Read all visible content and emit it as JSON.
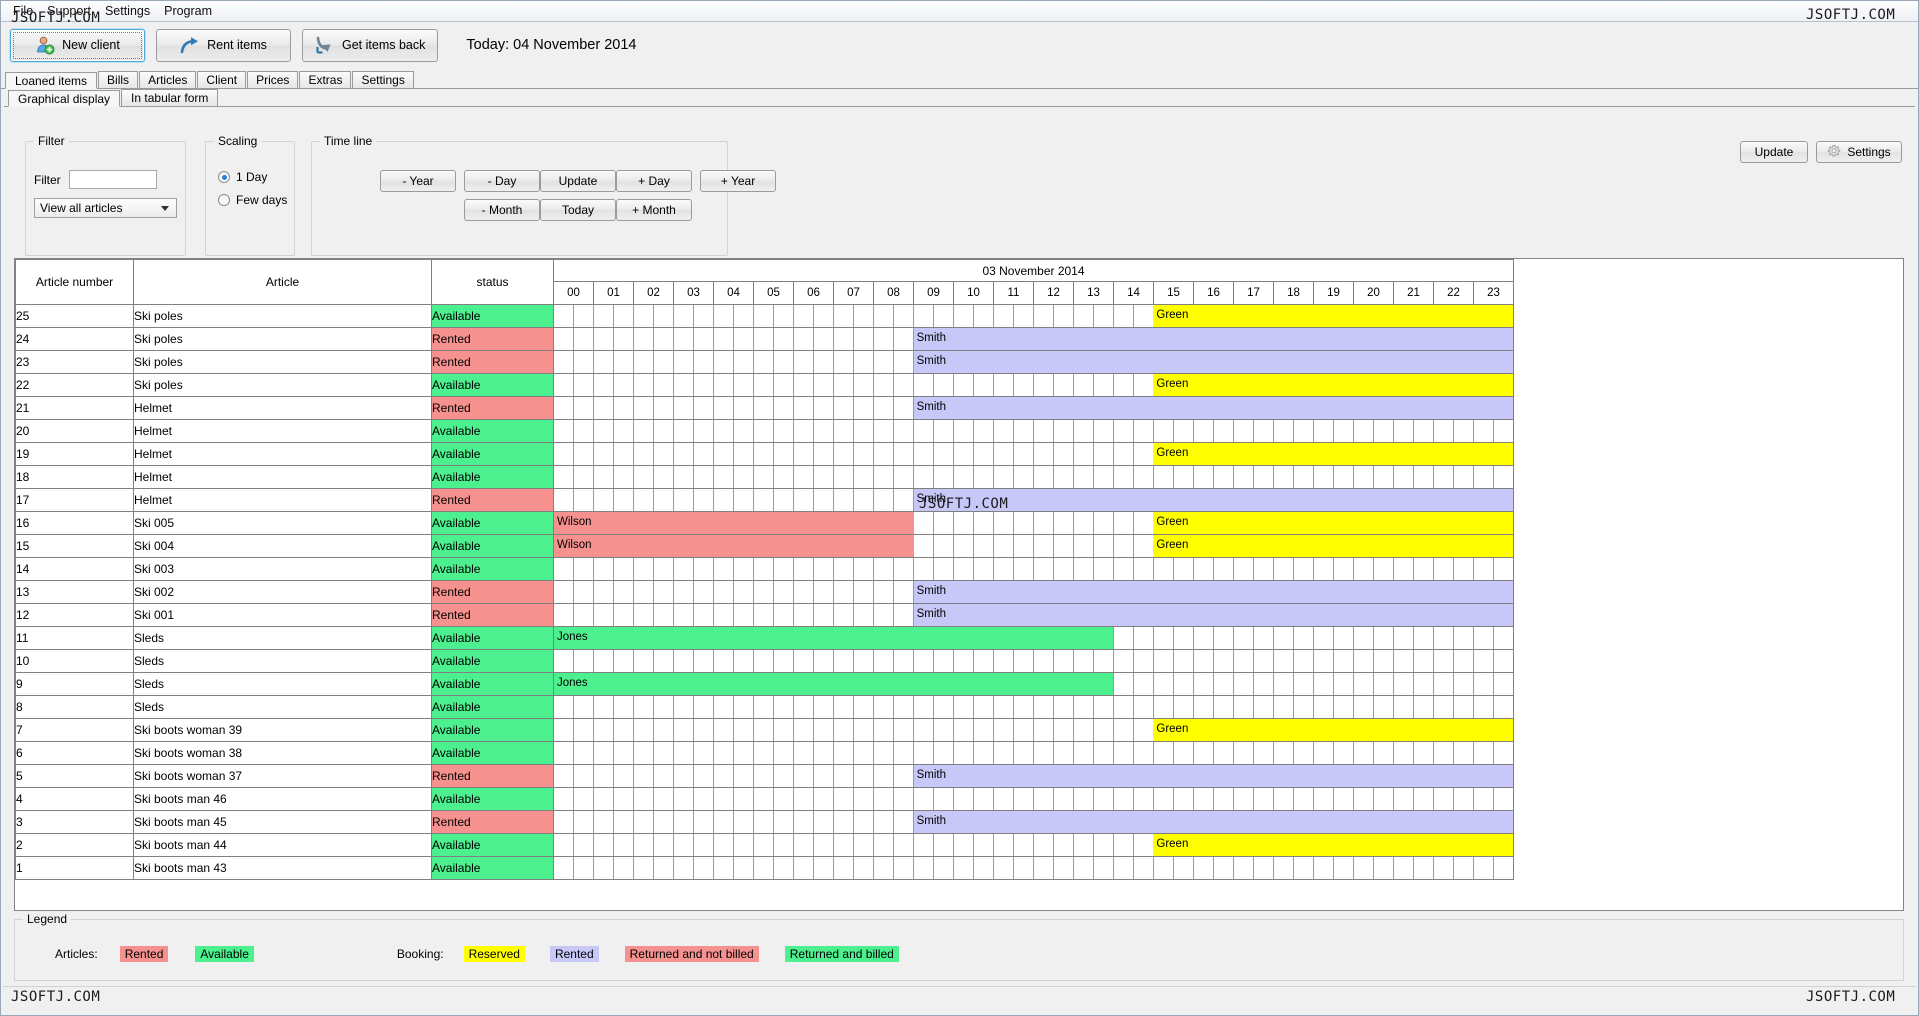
{
  "window": {
    "watermark": "JSOFTJ.COM"
  },
  "menu": {
    "items": [
      {
        "label": "File",
        "name": "menu-file"
      },
      {
        "label": "Support",
        "name": "menu-support"
      },
      {
        "label": "Settings",
        "name": "menu-settings"
      },
      {
        "label": "Program",
        "name": "menu-program"
      }
    ]
  },
  "toolbar": {
    "buttons": [
      {
        "label": "New client",
        "icon": "user-add-icon",
        "focused": true
      },
      {
        "label": "Rent items",
        "icon": "arrow-out-icon",
        "focused": false
      },
      {
        "label": "Get items back",
        "icon": "arrow-in-icon",
        "focused": false
      }
    ],
    "today_label": "Today: 04 November 2014"
  },
  "tabs_main": [
    {
      "label": "Loaned items",
      "active": true
    },
    {
      "label": "Bills",
      "active": false
    },
    {
      "label": "Articles",
      "active": false
    },
    {
      "label": "Client",
      "active": false
    },
    {
      "label": "Prices",
      "active": false
    },
    {
      "label": "Extras",
      "active": false
    },
    {
      "label": "Settings",
      "active": false
    }
  ],
  "tabs_sub": [
    {
      "label": "Graphical display",
      "active": true
    },
    {
      "label": "In tabular form",
      "active": false
    }
  ],
  "filter_panel": {
    "legend": "Filter",
    "field_label": "Filter",
    "field_value": "",
    "field_placeholder": "",
    "combo_value": "View all articles"
  },
  "scaling_panel": {
    "legend": "Scaling",
    "options": [
      {
        "label": "1 Day",
        "selected": true
      },
      {
        "label": "Few days",
        "selected": false
      }
    ]
  },
  "timeline_panel": {
    "legend": "Time line",
    "row1": [
      "- Year",
      "- Day",
      "Update",
      "+ Day",
      "+ Year"
    ],
    "row2": [
      "- Month",
      "Today",
      "+ Month"
    ]
  },
  "right_actions": {
    "update_label": "Update",
    "settings_label": "Settings",
    "settings_icon": "gear-icon"
  },
  "grid": {
    "columns": {
      "article_number": "Article number",
      "article": "Article",
      "status": "status"
    },
    "date_header": "03 November 2014",
    "hours": [
      "00",
      "01",
      "02",
      "03",
      "04",
      "05",
      "06",
      "07",
      "08",
      "09",
      "10",
      "11",
      "12",
      "13",
      "14",
      "15",
      "16",
      "17",
      "18",
      "19",
      "20",
      "21",
      "22",
      "23"
    ],
    "rows": [
      {
        "num": "25",
        "article": "Ski poles",
        "status": "Available",
        "bars": [
          {
            "label": "Green",
            "type": "reserved",
            "start": 15,
            "end": 24
          }
        ]
      },
      {
        "num": "24",
        "article": "Ski poles",
        "status": "Rented",
        "bars": [
          {
            "label": "Smith",
            "type": "rented",
            "start": 9,
            "end": 24
          }
        ]
      },
      {
        "num": "23",
        "article": "Ski poles",
        "status": "Rented",
        "bars": [
          {
            "label": "Smith",
            "type": "rented",
            "start": 9,
            "end": 24
          }
        ]
      },
      {
        "num": "22",
        "article": "Ski poles",
        "status": "Available",
        "bars": [
          {
            "label": "Green",
            "type": "reserved",
            "start": 15,
            "end": 24
          }
        ]
      },
      {
        "num": "21",
        "article": "Helmet",
        "status": "Rented",
        "bars": [
          {
            "label": "Smith",
            "type": "rented",
            "start": 9,
            "end": 24
          }
        ]
      },
      {
        "num": "20",
        "article": "Helmet",
        "status": "Available",
        "bars": []
      },
      {
        "num": "19",
        "article": "Helmet",
        "status": "Available",
        "bars": [
          {
            "label": "Green",
            "type": "reserved",
            "start": 15,
            "end": 24
          }
        ]
      },
      {
        "num": "18",
        "article": "Helmet",
        "status": "Available",
        "bars": []
      },
      {
        "num": "17",
        "article": "Helmet",
        "status": "Rented",
        "bars": [
          {
            "label": "Smith",
            "type": "rented",
            "start": 9,
            "end": 24
          }
        ]
      },
      {
        "num": "16",
        "article": "Ski 005",
        "status": "Available",
        "bars": [
          {
            "label": "Wilson",
            "type": "retnb",
            "start": 0,
            "end": 9
          },
          {
            "label": "Green",
            "type": "reserved",
            "start": 15,
            "end": 24
          }
        ]
      },
      {
        "num": "15",
        "article": "Ski 004",
        "status": "Available",
        "bars": [
          {
            "label": "Wilson",
            "type": "retnb",
            "start": 0,
            "end": 9
          },
          {
            "label": "Green",
            "type": "reserved",
            "start": 15,
            "end": 24
          }
        ]
      },
      {
        "num": "14",
        "article": "Ski 003",
        "status": "Available",
        "bars": []
      },
      {
        "num": "13",
        "article": "Ski 002",
        "status": "Rented",
        "bars": [
          {
            "label": "Smith",
            "type": "rented",
            "start": 9,
            "end": 24
          }
        ]
      },
      {
        "num": "12",
        "article": "Ski 001",
        "status": "Rented",
        "bars": [
          {
            "label": "Smith",
            "type": "rented",
            "start": 9,
            "end": 24
          }
        ]
      },
      {
        "num": "11",
        "article": "Sleds",
        "status": "Available",
        "bars": [
          {
            "label": "Jones",
            "type": "retb",
            "start": 0,
            "end": 14
          }
        ]
      },
      {
        "num": "10",
        "article": "Sleds",
        "status": "Available",
        "bars": []
      },
      {
        "num": "9",
        "article": "Sleds",
        "status": "Available",
        "bars": [
          {
            "label": "Jones",
            "type": "retb",
            "start": 0,
            "end": 14
          }
        ]
      },
      {
        "num": "8",
        "article": "Sleds",
        "status": "Available",
        "bars": []
      },
      {
        "num": "7",
        "article": "Ski boots woman 39",
        "status": "Available",
        "bars": [
          {
            "label": "Green",
            "type": "reserved",
            "start": 15,
            "end": 24
          }
        ]
      },
      {
        "num": "6",
        "article": "Ski boots woman 38",
        "status": "Available",
        "bars": []
      },
      {
        "num": "5",
        "article": "Ski boots woman 37",
        "status": "Rented",
        "bars": [
          {
            "label": "Smith",
            "type": "rented",
            "start": 9,
            "end": 24
          }
        ]
      },
      {
        "num": "4",
        "article": "Ski boots man 46",
        "status": "Available",
        "bars": []
      },
      {
        "num": "3",
        "article": "Ski boots man 45",
        "status": "Rented",
        "bars": [
          {
            "label": "Smith",
            "type": "rented",
            "start": 9,
            "end": 24
          }
        ]
      },
      {
        "num": "2",
        "article": "Ski boots man 44",
        "status": "Available",
        "bars": [
          {
            "label": "Green",
            "type": "reserved",
            "start": 15,
            "end": 24
          }
        ]
      },
      {
        "num": "1",
        "article": "Ski boots man 43",
        "status": "Available",
        "bars": []
      }
    ]
  },
  "legend": {
    "title": "Legend",
    "articles_label": "Articles:",
    "articles_items": [
      {
        "label": "Rented",
        "color": "#f5918f"
      },
      {
        "label": "Available",
        "color": "#4df08e"
      }
    ],
    "booking_label": "Booking:",
    "booking_items": [
      {
        "label": "Reserved",
        "color": "#ffff00"
      },
      {
        "label": "Rented",
        "color": "#c8c8f8"
      },
      {
        "label": "Returned and not billed",
        "color": "#f5918f"
      },
      {
        "label": "Returned and billed",
        "color": "#4df08e"
      }
    ]
  },
  "colors": {
    "available": "#4df08e",
    "rented_article": "#f5918f",
    "reserved": "#ffff00",
    "rented_booking": "#c8c8f8",
    "returned_not_billed": "#f5918f",
    "returned_billed": "#4df08e"
  }
}
